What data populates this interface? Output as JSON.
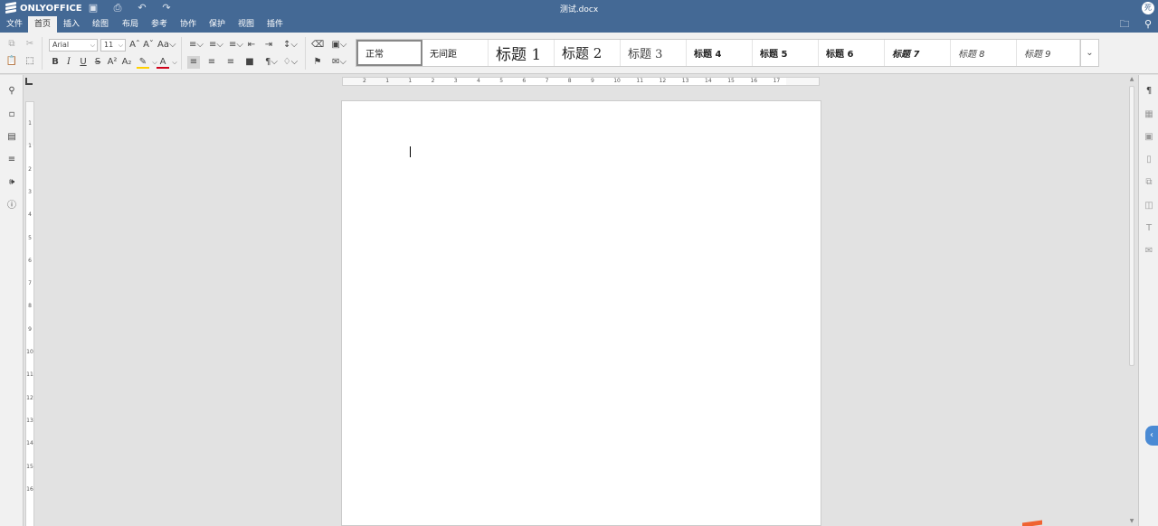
{
  "app": {
    "logo_text": "ONLYOFFICE",
    "document_title": "测试.docx",
    "user_initials": "死开"
  },
  "menu": {
    "items": [
      "文件",
      "首页",
      "插入",
      "绘图",
      "布局",
      "参考",
      "协作",
      "保护",
      "视图",
      "插件"
    ],
    "active": "首页"
  },
  "toolbar": {
    "font_name": "Arial",
    "font_size": "11"
  },
  "styles": [
    "正常",
    "无间距",
    "标题 1",
    "标题 2",
    "标题 3",
    "标题 4",
    "标题 5",
    "标题 6",
    "标题 7",
    "标题 8",
    "标题 9"
  ],
  "ruler": {
    "horizontal": [
      "2",
      "1",
      "1",
      "2",
      "3",
      "4",
      "5",
      "6",
      "7",
      "8",
      "9",
      "10",
      "11",
      "12",
      "13",
      "14",
      "15",
      "16",
      "17"
    ],
    "vertical": [
      "1",
      "1",
      "2",
      "3",
      "4",
      "5",
      "6",
      "7",
      "8",
      "9",
      "10",
      "11",
      "12",
      "13",
      "14",
      "15",
      "16"
    ]
  },
  "left_panel_icons": [
    "search-icon",
    "comment-icon",
    "chat-icon",
    "navigation-icon",
    "feedback-icon",
    "about-icon"
  ],
  "right_panel_icons": [
    "paragraph-settings-icon",
    "table-settings-icon",
    "image-settings-icon",
    "header-footer-icon",
    "shape-settings-icon",
    "chart-settings-icon",
    "text-art-icon",
    "mail-merge-icon"
  ],
  "colors": {
    "header": "#446995",
    "toolbar": "#f1f1f1",
    "canvas": "#e2e2e2",
    "highlight": "#ffd000",
    "font_color": "#d0021b",
    "accent": "#4a8ad4"
  }
}
